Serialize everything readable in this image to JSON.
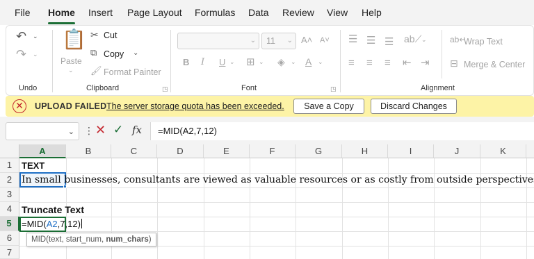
{
  "menu": {
    "tabs": [
      "File",
      "Home",
      "Insert",
      "Page Layout",
      "Formulas",
      "Data",
      "Review",
      "View",
      "Help"
    ],
    "active": "Home"
  },
  "ribbon": {
    "undo": {
      "label": "Undo"
    },
    "clipboard": {
      "label": "Clipboard",
      "paste": "Paste",
      "cut": "Cut",
      "copy": "Copy",
      "format_painter": "Format Painter"
    },
    "font": {
      "label": "Font",
      "size": "11",
      "bold": "B",
      "italic": "I",
      "underline": "U"
    },
    "alignment": {
      "label": "Alignment",
      "wrap_text": "Wrap Text",
      "merge_center": "Merge & Center"
    }
  },
  "notification": {
    "title": "UPLOAD FAILED",
    "message": "The server storage quota has been exceeded.",
    "save_copy": "Save a Copy",
    "discard": "Discard Changes"
  },
  "formula_bar": {
    "name_box": "",
    "fx": "fx",
    "formula": "=MID(A2,7,12)"
  },
  "grid": {
    "columns": [
      "A",
      "B",
      "C",
      "D",
      "E",
      "F",
      "G",
      "H",
      "I",
      "J",
      "K"
    ],
    "rows": [
      "1",
      "2",
      "3",
      "4",
      "5",
      "6",
      "7"
    ],
    "cells": {
      "A1": "TEXT",
      "A2": "In small businesses, consultants are viewed as valuable resources or as costly from outside perspectives.",
      "A4": "Truncate Text",
      "A5_prefix": "=MID(",
      "A5_ref": "A2",
      "A5_suffix": ",7,12)"
    },
    "tooltip": {
      "prefix": "MID(text, start_num, ",
      "bold": "num_chars",
      "suffix": ")"
    },
    "selection_color": "#1f6fc5",
    "accent_color": "#1b6e35"
  },
  "icons": {
    "undo": "undo-icon",
    "redo": "redo-icon",
    "paste": "clipboard-icon",
    "cut": "scissors-icon",
    "copy": "copy-icon",
    "format_painter": "paintbrush-icon",
    "error": "close-circle-icon",
    "cancel": "x-icon",
    "enter": "check-icon"
  }
}
